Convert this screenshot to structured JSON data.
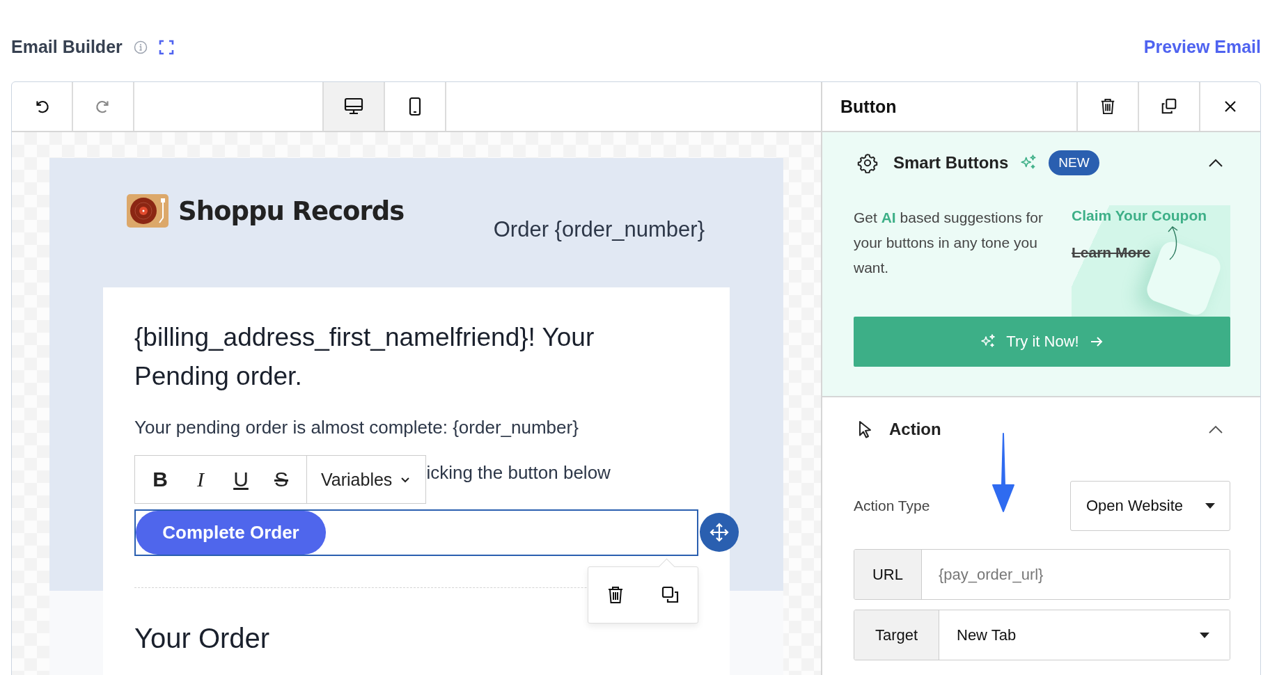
{
  "header": {
    "title": "Email Builder",
    "preview_link": "Preview Email"
  },
  "toolbar": {
    "devices": [
      {
        "kind": "desktop",
        "selected": true
      },
      {
        "kind": "mobile",
        "selected": false
      }
    ]
  },
  "email": {
    "brand": "Shoppu Records",
    "order_label": "Order {order_number}",
    "heading": "{billing_address_first_namelfriend}! Your Pending order.",
    "paragraphs": [
      "Your pending order is almost complete: {order_number}",
      "icking the button below"
    ],
    "format_buttons": [
      {
        "kind": "bold",
        "label": "B"
      },
      {
        "kind": "italic",
        "label": "I"
      },
      {
        "kind": "underline",
        "label": "U"
      },
      {
        "kind": "strike",
        "label": "S"
      }
    ],
    "variables_label": "Variables",
    "button_label": "Complete Order",
    "section_title": "Your Order"
  },
  "panel": {
    "title": "Button",
    "smart_buttons": {
      "title": "Smart Buttons",
      "badge": "NEW",
      "expanded": true,
      "description": "Get **AI** based suggestions for your buttons in any tone you want.",
      "promo_title": "Claim Your Coupon",
      "promo_struck": "Learn More",
      "cta": "Try it Now!"
    },
    "action": {
      "title": "Action",
      "expanded": true,
      "type_label": "Action Type",
      "type_value": "Open Website",
      "url_label": "URL",
      "url_placeholder": "{pay_order_url}",
      "target_label": "Target",
      "target_value": "New Tab"
    }
  }
}
